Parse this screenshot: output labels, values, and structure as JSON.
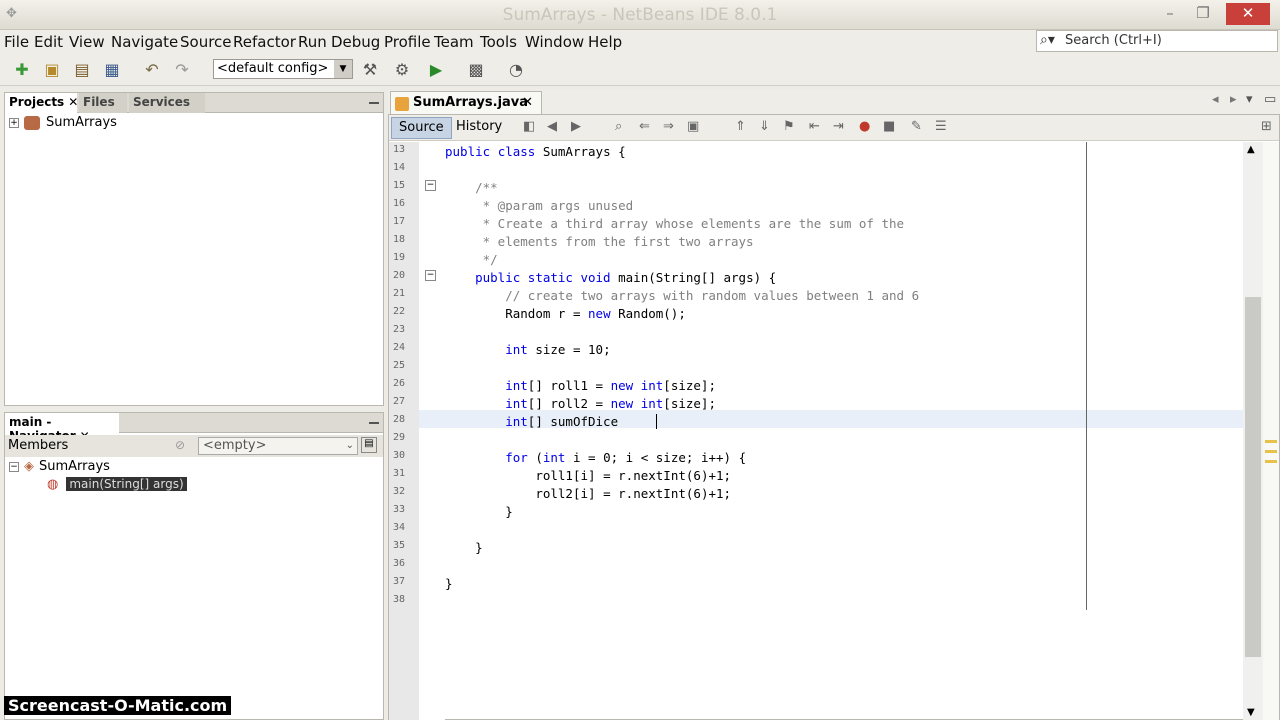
{
  "window": {
    "title": "SumArrays - NetBeans IDE 8.0.1"
  },
  "menu": [
    "File",
    "Edit",
    "View",
    "Navigate",
    "Source",
    "Refactor",
    "Run",
    "Debug",
    "Profile",
    "Team",
    "Tools",
    "Window",
    "Help"
  ],
  "search": {
    "placeholder": "Search (Ctrl+I)"
  },
  "toolbar": {
    "config": "<default config>"
  },
  "projects_panel": {
    "tabs": [
      "Projects",
      "Files",
      "Services"
    ],
    "tree": [
      {
        "label": "SumArrays"
      }
    ]
  },
  "navigator": {
    "title": "main - Navigator",
    "members_label": "Members",
    "filter": "<empty>",
    "class_name": "SumArrays",
    "member": "main(String[] args)"
  },
  "editor": {
    "tab": "SumArrays.java",
    "source_label": "Source",
    "history_label": "History",
    "line_numbers": [
      "13",
      "14",
      "15",
      "16",
      "17",
      "18",
      "19",
      "20",
      "21",
      "22",
      "23",
      "24",
      "25",
      "26",
      "27",
      "28",
      "29",
      "30",
      "31",
      "32",
      "33",
      "34",
      "35",
      "36",
      "37",
      "38"
    ],
    "lines": [
      "public class SumArrays {",
      "",
      "    /**",
      "     * @param args unused",
      "     * Create a third array whose elements are the sum of the",
      "     * elements from the first two arrays",
      "     */",
      "    public static void main(String[] args) {",
      "        // create two arrays with random values between 1 and 6",
      "        Random r = new Random();",
      "",
      "        int size = 10;",
      "",
      "        int[] roll1 = new int[size];",
      "        int[] roll2 = new int[size];",
      "        int[] sumOfDice",
      "",
      "        for (int i = 0; i < size; i++) {",
      "            roll1[i] = r.nextInt(6)+1;",
      "            roll2[i] = r.nextInt(6)+1;",
      "        }",
      "",
      "    }",
      "",
      "}",
      ""
    ]
  },
  "watermark": "Screencast-O-Matic.com"
}
